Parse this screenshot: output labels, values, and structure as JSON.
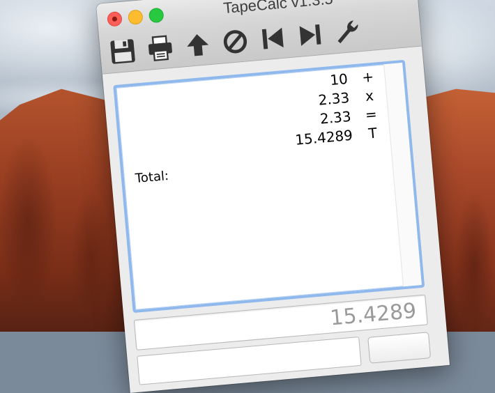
{
  "window": {
    "title": "TapeCalc v1.3.5"
  },
  "toolbar": {
    "buttons": [
      {
        "icon": "save-icon"
      },
      {
        "icon": "print-icon"
      },
      {
        "icon": "arrow-up-icon"
      },
      {
        "icon": "clear-icon"
      },
      {
        "icon": "skip-back-icon"
      },
      {
        "icon": "skip-forward-icon"
      },
      {
        "icon": "wrench-icon"
      }
    ]
  },
  "tape": {
    "lines": [
      {
        "value": "10",
        "op": "+"
      },
      {
        "value": "2.33",
        "op": "x"
      },
      {
        "value": "2.33",
        "op": "="
      },
      {
        "value": "15.4289",
        "op": "T"
      }
    ],
    "total_label": "Total:"
  },
  "display": {
    "result": "15.4289"
  },
  "colors": {
    "focus_ring": "#8fb8ec",
    "close": "#fc5f57",
    "minimize": "#fdbc2e",
    "maximize": "#28c840"
  }
}
